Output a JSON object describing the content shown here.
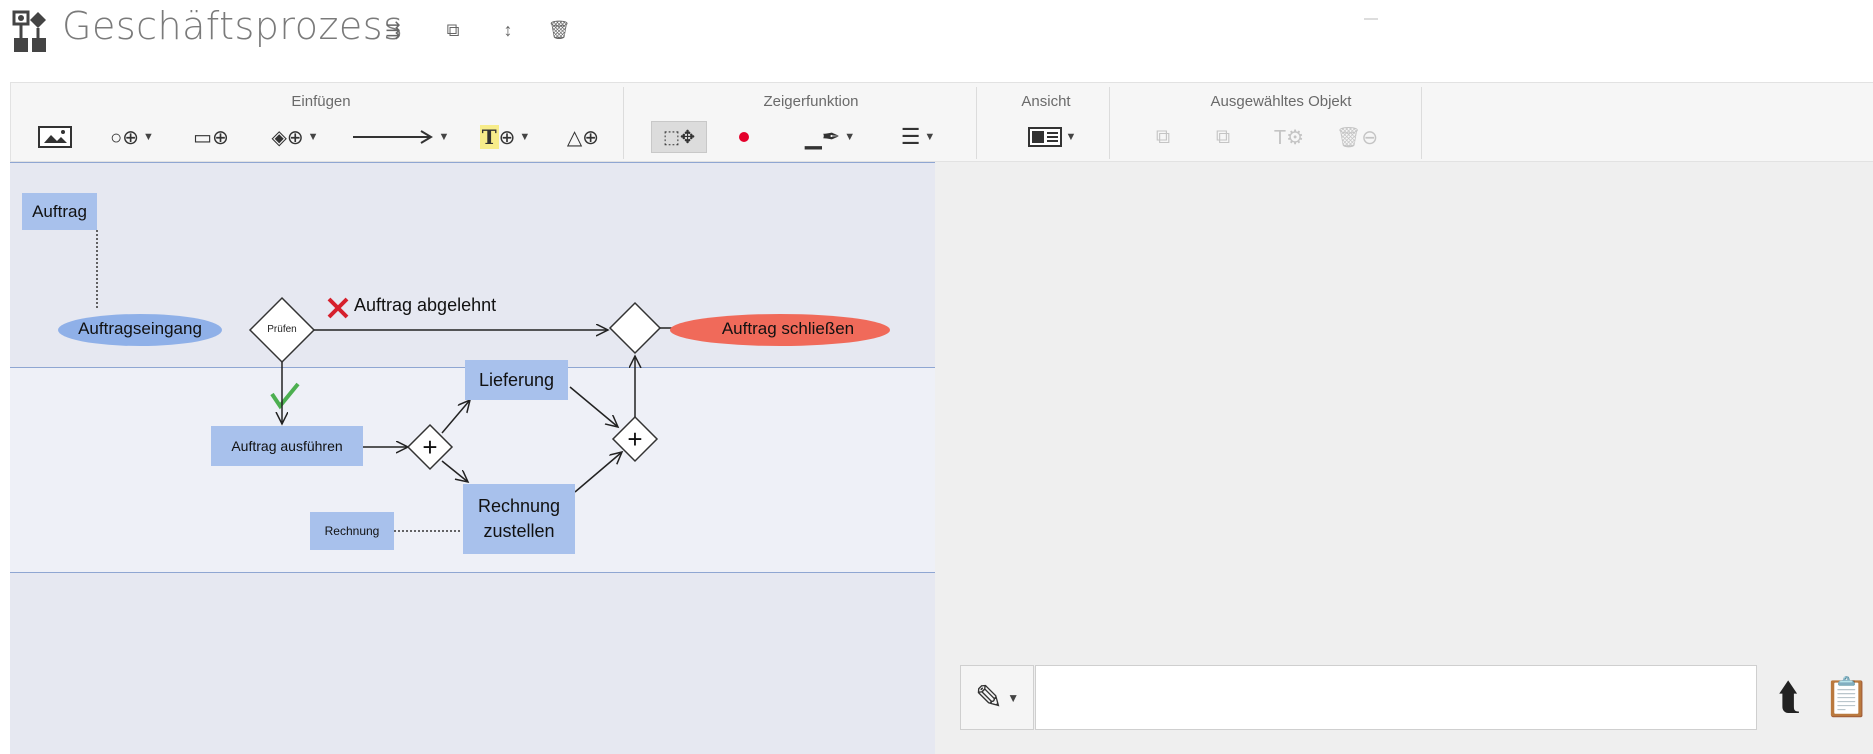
{
  "title": "Geschäftsprozess",
  "title_tools": [
    "rename-icon",
    "copy-icon",
    "sort-icon",
    "delete-icon"
  ],
  "ribbon": {
    "groups": [
      {
        "label": "Einfügen"
      },
      {
        "label": "Zeigerfunktion"
      },
      {
        "label": "Ansicht"
      },
      {
        "label": "Ausgewähltes Objekt"
      }
    ],
    "text_tool_label": "T"
  },
  "diagram": {
    "auftrag": "Auftrag",
    "auftragseingang": "Auftragseingang",
    "pruefen": "Prüfen",
    "abgelehnt": "Auftrag abgelehnt",
    "schliessen": "Auftrag schließen",
    "lieferung": "Lieferung",
    "ausfuehren": "Auftrag ausführen",
    "rechnung_doc": "Rechnung",
    "rechnung_zustellen_1": "Rechnung",
    "rechnung_zustellen_2": "zustellen"
  },
  "notes": {
    "input_value": "",
    "input_placeholder": ""
  },
  "colors": {
    "task_fill": "#a8c1ec",
    "event_start": "#8fb0e8",
    "event_end": "#f06a5a",
    "lane_line": "#8fa6d2",
    "reject_mark": "#d6202c",
    "accept_mark": "#4caf50"
  }
}
